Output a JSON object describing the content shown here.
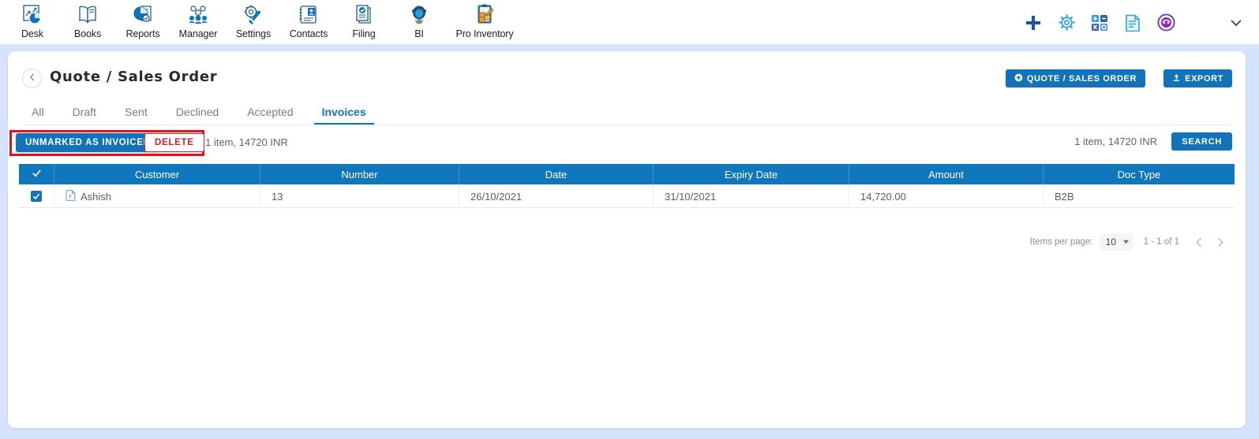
{
  "topnav": {
    "apps": [
      {
        "label": "Desk",
        "icon": "dashboard-chart-icon"
      },
      {
        "label": "Books",
        "icon": "open-book-icon"
      },
      {
        "label": "Reports",
        "icon": "pie-chart-report-icon"
      },
      {
        "label": "Manager",
        "icon": "people-gear-icon"
      },
      {
        "label": "Settings",
        "icon": "gear-wrench-icon"
      },
      {
        "label": "Contacts",
        "icon": "contact-card-icon"
      },
      {
        "label": "Filing",
        "icon": "document-check-icon"
      },
      {
        "label": "BI",
        "icon": "robot-icon"
      },
      {
        "label": "Pro Inventory",
        "icon": "clipboard-boxes-icon"
      }
    ],
    "actions": [
      {
        "icon": "plus-icon"
      },
      {
        "icon": "gear-icon"
      },
      {
        "icon": "calculator-icon"
      },
      {
        "icon": "notes-icon"
      },
      {
        "icon": "support-badge-icon"
      }
    ],
    "expand": {
      "icon": "chevron-down-icon"
    }
  },
  "header": {
    "back_icon": "chevron-left-icon",
    "title": "Quote / Sales Order",
    "quote_button": {
      "label": "QUOTE / SALES ORDER",
      "icon": "plus-circle-icon"
    },
    "export_button": {
      "label": "EXPORT",
      "icon": "upload-icon"
    }
  },
  "tabs": [
    {
      "label": "All",
      "active": false
    },
    {
      "label": "Draft",
      "active": false
    },
    {
      "label": "Sent",
      "active": false
    },
    {
      "label": "Declined",
      "active": false
    },
    {
      "label": "Accepted",
      "active": false
    },
    {
      "label": "Invoices",
      "active": true
    }
  ],
  "toolbar": {
    "unmark_label": "UNMARKED AS INVOICED",
    "delete_label": "DELETE",
    "summary_left": "1 item, 14720 INR",
    "summary_right": "1 item, 14720 INR",
    "search_label": "SEARCH",
    "highlight_color": "#e8101b"
  },
  "table": {
    "select_all_icon": "checkmark-icon",
    "columns": [
      "Customer",
      "Number",
      "Date",
      "Expiry Date",
      "Amount",
      "Doc Type"
    ],
    "rows": [
      {
        "selected": true,
        "row_icon": "file-contact-icon",
        "customer": "Ashish",
        "number": "13",
        "date": "26/10/2021",
        "expiry_date": "31/10/2021",
        "amount": "14,720.00",
        "doc_type": "B2B"
      }
    ]
  },
  "pagination": {
    "items_per_page_label": "Items per page:",
    "items_per_page_value": "10",
    "dropdown_icon": "caret-down-icon",
    "range": "1 - 1 of 1",
    "prev_icon": "chevron-left-icon",
    "next_icon": "chevron-right-icon"
  },
  "colors": {
    "primary": "#1273b8",
    "table_header": "#0f77bd",
    "page_background": "#d6e4fb",
    "danger": "#cf2027"
  }
}
